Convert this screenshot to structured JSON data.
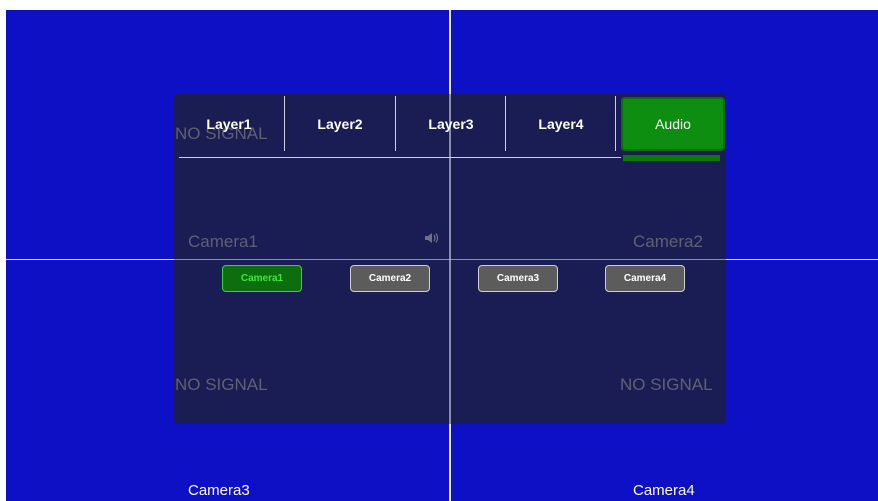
{
  "background_labels": {
    "camera3": "Camera3",
    "camera4": "Camera4"
  },
  "panel_ghost": {
    "no_signal_tl": "NO SIGNAL",
    "camera1": "Camera1",
    "camera2": "Camera2",
    "no_signal_bl": "NO SIGNAL",
    "no_signal_br": "NO SIGNAL"
  },
  "tabs": [
    {
      "label": "Layer1"
    },
    {
      "label": "Layer2"
    },
    {
      "label": "Layer3"
    },
    {
      "label": "Layer4"
    },
    {
      "label": "Audio",
      "active": true
    }
  ],
  "audio_sources": [
    {
      "label": "Camera1",
      "selected": true
    },
    {
      "label": "Camera2",
      "selected": false
    },
    {
      "label": "Camera3",
      "selected": false
    },
    {
      "label": "Camera4",
      "selected": false
    }
  ],
  "icons": {
    "speaker": "speaker-icon"
  },
  "colors": {
    "background": "#0d10c4",
    "panel": "#1c1e4a",
    "accent_green": "#0e8e10",
    "selected_text": "#3be83b",
    "button_gray": "#5c5c5c"
  }
}
